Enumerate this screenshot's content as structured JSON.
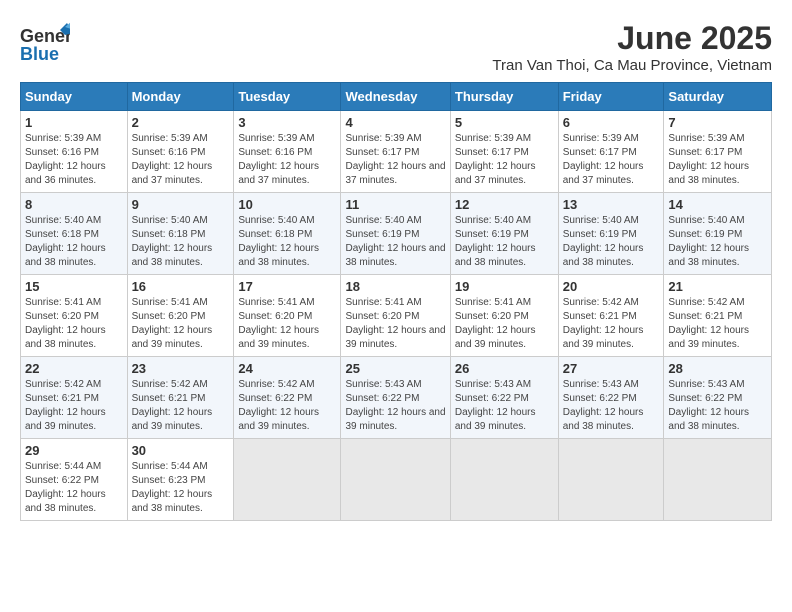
{
  "header": {
    "logo_line1": "General",
    "logo_line2": "Blue",
    "title": "June 2025",
    "subtitle": "Tran Van Thoi, Ca Mau Province, Vietnam"
  },
  "calendar": {
    "days_of_week": [
      "Sunday",
      "Monday",
      "Tuesday",
      "Wednesday",
      "Thursday",
      "Friday",
      "Saturday"
    ],
    "weeks": [
      [
        null,
        {
          "day": "2",
          "sunrise": "5:39 AM",
          "sunset": "6:16 PM",
          "daylight": "12 hours and 37 minutes."
        },
        {
          "day": "3",
          "sunrise": "5:39 AM",
          "sunset": "6:16 PM",
          "daylight": "12 hours and 37 minutes."
        },
        {
          "day": "4",
          "sunrise": "5:39 AM",
          "sunset": "6:17 PM",
          "daylight": "12 hours and 37 minutes."
        },
        {
          "day": "5",
          "sunrise": "5:39 AM",
          "sunset": "6:17 PM",
          "daylight": "12 hours and 37 minutes."
        },
        {
          "day": "6",
          "sunrise": "5:39 AM",
          "sunset": "6:17 PM",
          "daylight": "12 hours and 37 minutes."
        },
        {
          "day": "7",
          "sunrise": "5:39 AM",
          "sunset": "6:17 PM",
          "daylight": "12 hours and 38 minutes."
        }
      ],
      [
        {
          "day": "1",
          "sunrise": "5:39 AM",
          "sunset": "6:16 PM",
          "daylight": "12 hours and 36 minutes."
        },
        {
          "day": "8",
          "sunrise": null,
          "sunset": null,
          "daylight": null
        },
        {
          "day": "9",
          "sunrise": "5:40 AM",
          "sunset": "6:18 PM",
          "daylight": "12 hours and 38 minutes."
        },
        {
          "day": "10",
          "sunrise": "5:40 AM",
          "sunset": "6:18 PM",
          "daylight": "12 hours and 38 minutes."
        },
        {
          "day": "11",
          "sunrise": "5:40 AM",
          "sunset": "6:19 PM",
          "daylight": "12 hours and 38 minutes."
        },
        {
          "day": "12",
          "sunrise": "5:40 AM",
          "sunset": "6:19 PM",
          "daylight": "12 hours and 38 minutes."
        },
        {
          "day": "13",
          "sunrise": "5:40 AM",
          "sunset": "6:19 PM",
          "daylight": "12 hours and 38 minutes."
        }
      ],
      [
        {
          "day": "14",
          "sunrise": "5:40 AM",
          "sunset": "6:19 PM",
          "daylight": "12 hours and 38 minutes."
        },
        {
          "day": "15",
          "sunrise": null,
          "sunset": null,
          "daylight": null
        },
        {
          "day": "16",
          "sunrise": "5:41 AM",
          "sunset": "6:20 PM",
          "daylight": "12 hours and 39 minutes."
        },
        {
          "day": "17",
          "sunrise": "5:41 AM",
          "sunset": "6:20 PM",
          "daylight": "12 hours and 39 minutes."
        },
        {
          "day": "18",
          "sunrise": "5:41 AM",
          "sunset": "6:20 PM",
          "daylight": "12 hours and 39 minutes."
        },
        {
          "day": "19",
          "sunrise": "5:41 AM",
          "sunset": "6:20 PM",
          "daylight": "12 hours and 39 minutes."
        },
        {
          "day": "20",
          "sunrise": "5:42 AM",
          "sunset": "6:21 PM",
          "daylight": "12 hours and 39 minutes."
        }
      ],
      [
        {
          "day": "21",
          "sunrise": "5:42 AM",
          "sunset": "6:21 PM",
          "daylight": "12 hours and 39 minutes."
        },
        {
          "day": "22",
          "sunrise": null,
          "sunset": null,
          "daylight": null
        },
        {
          "day": "23",
          "sunrise": "5:42 AM",
          "sunset": "6:21 PM",
          "daylight": "12 hours and 39 minutes."
        },
        {
          "day": "24",
          "sunrise": "5:42 AM",
          "sunset": "6:22 PM",
          "daylight": "12 hours and 39 minutes."
        },
        {
          "day": "25",
          "sunrise": "5:43 AM",
          "sunset": "6:22 PM",
          "daylight": "12 hours and 39 minutes."
        },
        {
          "day": "26",
          "sunrise": "5:43 AM",
          "sunset": "6:22 PM",
          "daylight": "12 hours and 39 minutes."
        },
        {
          "day": "27",
          "sunrise": "5:43 AM",
          "sunset": "6:22 PM",
          "daylight": "12 hours and 38 minutes."
        }
      ],
      [
        {
          "day": "28",
          "sunrise": "5:43 AM",
          "sunset": "6:22 PM",
          "daylight": "12 hours and 38 minutes."
        },
        {
          "day": "29",
          "sunrise": null,
          "sunset": null,
          "daylight": null
        },
        {
          "day": "30",
          "sunrise": "5:44 AM",
          "sunset": "6:23 PM",
          "daylight": "12 hours and 38 minutes."
        },
        null,
        null,
        null,
        null
      ]
    ]
  },
  "cell_data": {
    "week1": {
      "sun": {
        "day": "1",
        "sunrise": "5:39 AM",
        "sunset": "6:16 PM",
        "daylight": "12 hours and 36 minutes."
      },
      "mon": {
        "day": "2",
        "sunrise": "5:39 AM",
        "sunset": "6:16 PM",
        "daylight": "12 hours and 37 minutes."
      },
      "tue": {
        "day": "3",
        "sunrise": "5:39 AM",
        "sunset": "6:16 PM",
        "daylight": "12 hours and 37 minutes."
      },
      "wed": {
        "day": "4",
        "sunrise": "5:39 AM",
        "sunset": "6:17 PM",
        "daylight": "12 hours and 37 minutes."
      },
      "thu": {
        "day": "5",
        "sunrise": "5:39 AM",
        "sunset": "6:17 PM",
        "daylight": "12 hours and 37 minutes."
      },
      "fri": {
        "day": "6",
        "sunrise": "5:39 AM",
        "sunset": "6:17 PM",
        "daylight": "12 hours and 37 minutes."
      },
      "sat": {
        "day": "7",
        "sunrise": "5:39 AM",
        "sunset": "6:17 PM",
        "daylight": "12 hours and 38 minutes."
      }
    }
  }
}
